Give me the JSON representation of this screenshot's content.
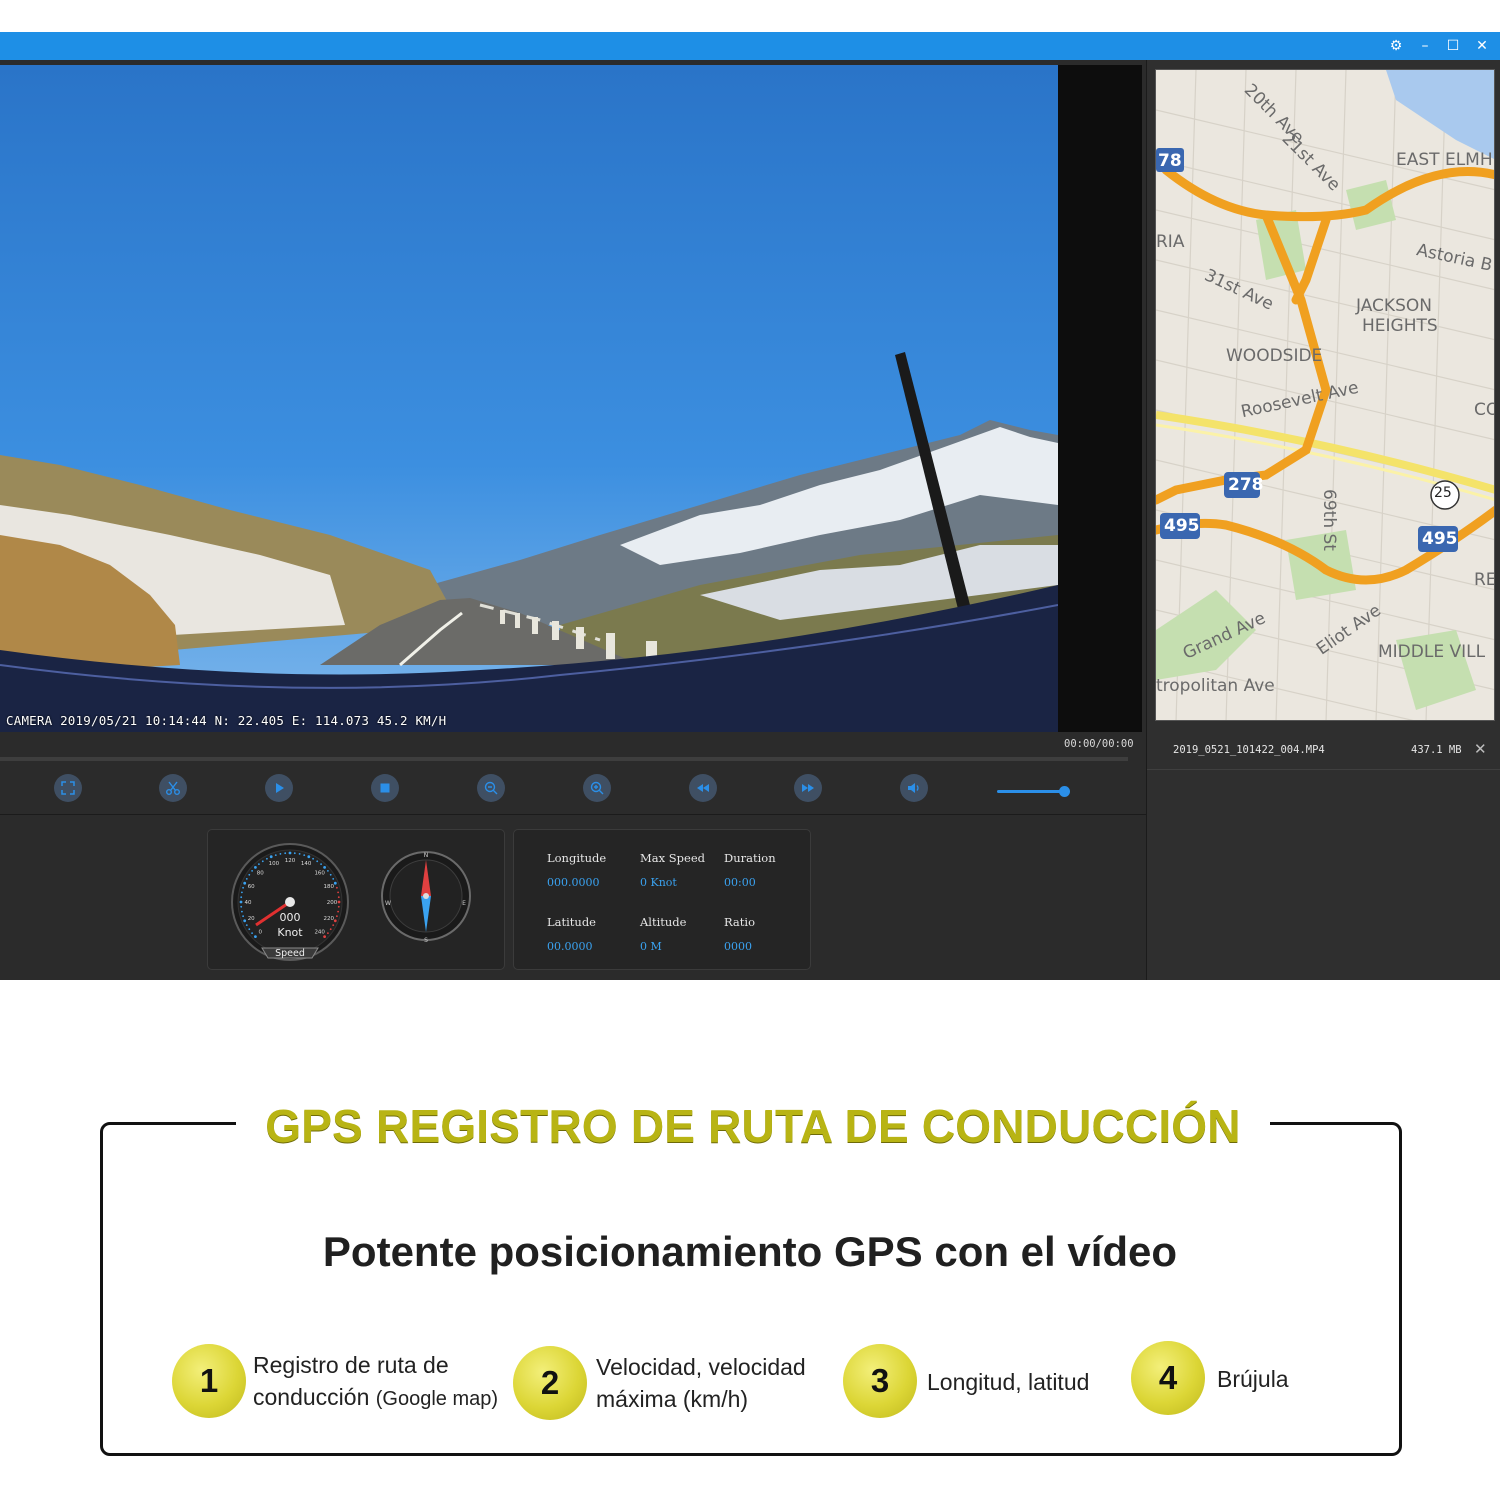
{
  "window": {
    "controls": [
      "settings-icon",
      "minimize-icon",
      "maximize-icon",
      "close-icon"
    ]
  },
  "video": {
    "osd": "CAMERA 2019/05/21 10:14:44 N: 22.405 E: 114.073 45.2 KM/H",
    "timecode": "00:00/00:00",
    "volume_level": 1.0
  },
  "toolbar": {
    "buttons": [
      "fullscreen-icon",
      "cut-icon",
      "play-icon",
      "stop-icon",
      "zoom-out-icon",
      "zoom-in-icon",
      "rewind-icon",
      "fast-forward-icon",
      "volume-icon"
    ]
  },
  "speedometer": {
    "ticks": [
      "0",
      "20",
      "40",
      "60",
      "80",
      "100",
      "120",
      "140",
      "160",
      "180",
      "200",
      "220",
      "240"
    ],
    "value": "000",
    "unit": "Knot",
    "label": "Speed"
  },
  "compass": {
    "n": "N",
    "s": "S",
    "e": "E",
    "w": "W"
  },
  "info": {
    "longitude_label": "Longitude",
    "longitude_value": "000.0000",
    "max_speed_label": "Max Speed",
    "max_speed_value": "0 Knot",
    "duration_label": "Duration",
    "duration_value": "00:00",
    "latitude_label": "Latitude",
    "latitude_value": "00.0000",
    "altitude_label": "Altitude",
    "altitude_value": "0 M",
    "ratio_label": "Ratio",
    "ratio_value": "0000"
  },
  "map": {
    "labels": [
      "20th Ave",
      "21st Ave",
      "EAST ELMH",
      "78",
      "RIA",
      "Astoria B",
      "31st Ave",
      "JACKSON",
      "HEIGHTS",
      "WOODSIDE",
      "Roosevelt Ave",
      "CO",
      "278",
      "69th St",
      "25",
      "495",
      "495",
      "RE",
      "Grand Ave",
      "Eliot Ave",
      "MIDDLE VILL",
      "tropolitan Ave"
    ]
  },
  "playlist": {
    "file_name": "2019_0521_101422_004.MP4",
    "file_size": "437.1 MB"
  },
  "promo": {
    "title": "GPS REGISTRO DE RUTA DE CONDUCCIÓN",
    "subtitle": "Potente posicionamiento GPS con el vídeo",
    "features": [
      {
        "num": "1",
        "line1": "Registro de ruta de",
        "line2": "conducción",
        "note": "(Google map)"
      },
      {
        "num": "2",
        "line1": "Velocidad, velocidad",
        "line2": "máxima (km/h)"
      },
      {
        "num": "3",
        "line1": "Longitud, latitud"
      },
      {
        "num": "4",
        "line1": "Brújula"
      }
    ]
  },
  "colors": {
    "titlebar": "#1e8fe6",
    "accent": "#3aa2f0",
    "promo_title": "#b8b414",
    "route": "#f0a020"
  }
}
